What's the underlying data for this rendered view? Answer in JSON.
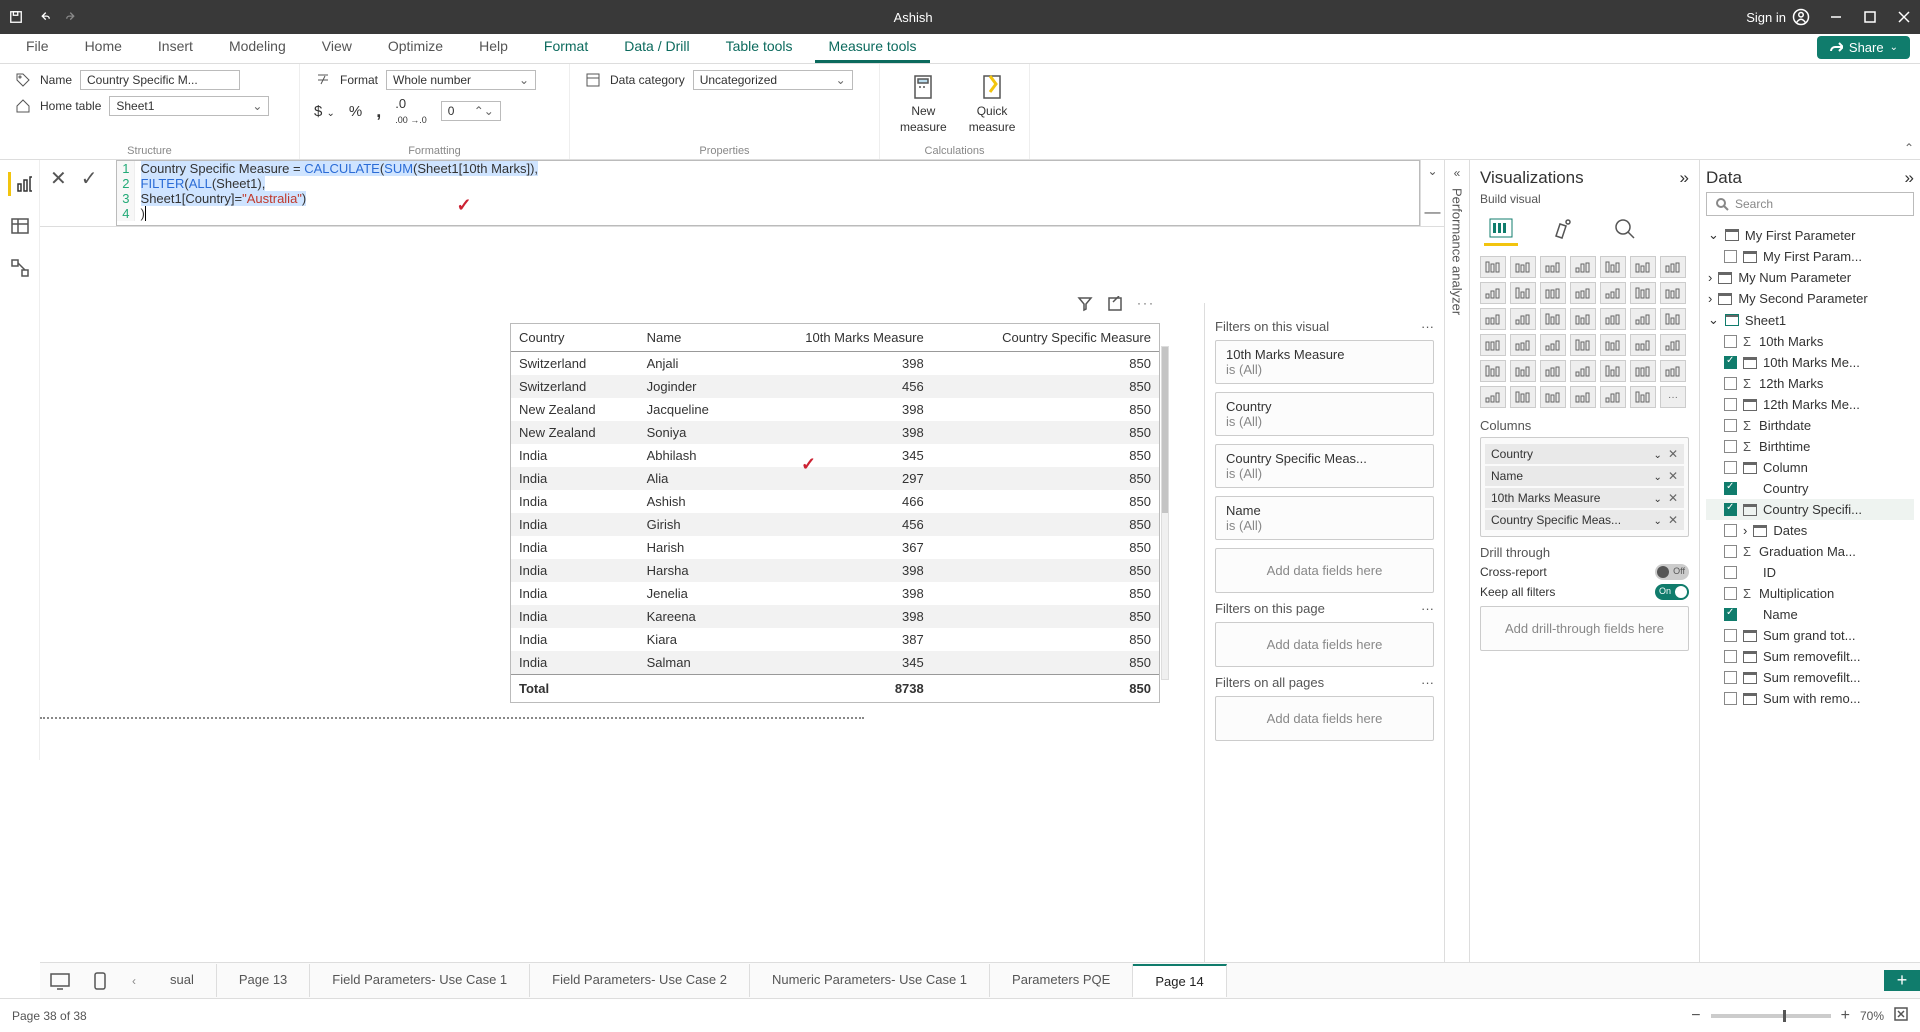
{
  "titlebar": {
    "title": "Ashish",
    "signin": "Sign in"
  },
  "ribbonTabs": [
    "File",
    "Home",
    "Insert",
    "Modeling",
    "View",
    "Optimize",
    "Help",
    "Format",
    "Data / Drill",
    "Table tools",
    "Measure tools"
  ],
  "ribbonActive": "Measure tools",
  "share": "Share",
  "ribbon": {
    "structure": {
      "nameLabel": "Name",
      "nameValue": "Country Specific M...",
      "homeTableLabel": "Home table",
      "homeTableValue": "Sheet1",
      "group": "Structure"
    },
    "formatting": {
      "formatLabel": "Format",
      "formatValue": "Whole number",
      "decimals": "0",
      "group": "Formatting"
    },
    "properties": {
      "dataCatLabel": "Data category",
      "dataCatValue": "Uncategorized",
      "group": "Properties"
    },
    "calculations": {
      "newMeasure": "New measure",
      "quickMeasure": "Quick measure",
      "group": "Calculations",
      "newTop": "New",
      "newBottom": "measure",
      "quickTop": "Quick",
      "quickBottom": "measure"
    }
  },
  "formula": {
    "l1a": "Country Specific Measure = ",
    "l1b": "CALCULATE",
    "l1c": "(",
    "l1d": "SUM",
    "l1e": "(Sheet1[10th Marks]),",
    "l2a": "FILTER",
    "l2b": "(",
    "l2c": "ALL",
    "l2d": "(Sheet1),",
    "l3a": "Sheet1[",
    "l3b": "Country",
    "l3c": "]=",
    "l3d": "\"Australia\"",
    "l3e": ")",
    "l4": ")"
  },
  "table": {
    "headers": [
      "Country",
      "Name",
      "10th Marks Measure",
      "Country Specific Measure"
    ],
    "rows": [
      [
        "Switzerland",
        "Anjali",
        "398",
        "850"
      ],
      [
        "Switzerland",
        "Joginder",
        "456",
        "850"
      ],
      [
        "New Zealand",
        "Jacqueline",
        "398",
        "850"
      ],
      [
        "New Zealand",
        "Soniya",
        "398",
        "850"
      ],
      [
        "India",
        "Abhilash",
        "345",
        "850"
      ],
      [
        "India",
        "Alia",
        "297",
        "850"
      ],
      [
        "India",
        "Ashish",
        "466",
        "850"
      ],
      [
        "India",
        "Girish",
        "456",
        "850"
      ],
      [
        "India",
        "Harish",
        "367",
        "850"
      ],
      [
        "India",
        "Harsha",
        "398",
        "850"
      ],
      [
        "India",
        "Jenelia",
        "398",
        "850"
      ],
      [
        "India",
        "Kareena",
        "398",
        "850"
      ],
      [
        "India",
        "Kiara",
        "387",
        "850"
      ],
      [
        "India",
        "Salman",
        "345",
        "850"
      ]
    ],
    "totalLabel": "Total",
    "total10": "8738",
    "totalCsm": "850"
  },
  "filters": {
    "visualHeader": "Filters on this visual",
    "cards": [
      {
        "t": "10th Marks Measure",
        "s": "is (All)"
      },
      {
        "t": "Country",
        "s": "is (All)"
      },
      {
        "t": "Country Specific Meas...",
        "s": "is (All)"
      },
      {
        "t": "Name",
        "s": "is (All)"
      }
    ],
    "addHere": "Add data fields here",
    "pageHeader": "Filters on this page",
    "allHeader": "Filters on all pages"
  },
  "perf": "Performance analyzer",
  "viz": {
    "title": "Visualizations",
    "sub": "Build visual",
    "columns": "Columns",
    "chips": [
      "Country",
      "Name",
      "10th Marks Measure",
      "Country Specific Meas..."
    ],
    "drill": "Drill through",
    "cross": "Cross-report",
    "crossState": "Off",
    "keep": "Keep all filters",
    "keepState": "On",
    "addDrill": "Add drill-through fields here"
  },
  "data": {
    "title": "Data",
    "searchPlaceholder": "Search",
    "tree": {
      "p1": "My First Parameter",
      "p1f": "My First Param...",
      "p2": "My Num Parameter",
      "p3": "My Second Parameter",
      "sheet": "Sheet1",
      "fields": [
        {
          "n": "10th Marks",
          "sigma": true,
          "checked": false
        },
        {
          "n": "10th Marks Me...",
          "calc": true,
          "checked": true
        },
        {
          "n": "12th Marks",
          "sigma": true,
          "checked": false
        },
        {
          "n": "12th Marks Me...",
          "calc": true,
          "checked": false
        },
        {
          "n": "Birthdate",
          "sigma": true,
          "checked": false
        },
        {
          "n": "Birthtime",
          "sigma": true,
          "checked": false
        },
        {
          "n": "Column",
          "calc": true,
          "checked": false
        },
        {
          "n": "Country",
          "plain": true,
          "checked": true
        },
        {
          "n": "Country Specifi...",
          "calc": true,
          "checked": true,
          "sel": true
        },
        {
          "n": "Dates",
          "calc": true,
          "checked": false,
          "expand": true
        },
        {
          "n": "Graduation Ma...",
          "sigma": true,
          "checked": false
        },
        {
          "n": "ID",
          "plain": true,
          "checked": false
        },
        {
          "n": "Multiplication",
          "sigma": true,
          "checked": false
        },
        {
          "n": "Name",
          "plain": true,
          "checked": true
        },
        {
          "n": "Sum grand tot...",
          "calc": true,
          "checked": false
        },
        {
          "n": "Sum removefilt...",
          "calc": true,
          "checked": false
        },
        {
          "n": "Sum removefilt...",
          "calc": true,
          "checked": false
        },
        {
          "n": "Sum with remo...",
          "calc": true,
          "checked": false
        }
      ]
    }
  },
  "pages": {
    "tabs": [
      "sual",
      "Page 13",
      "Field Parameters- Use Case 1",
      "Field Parameters- Use Case 2",
      "Numeric Parameters- Use Case 1",
      "Parameters PQE",
      "Page 14"
    ],
    "active": "Page 14"
  },
  "status": {
    "left": "Page 38 of 38",
    "zoom": "70%"
  }
}
